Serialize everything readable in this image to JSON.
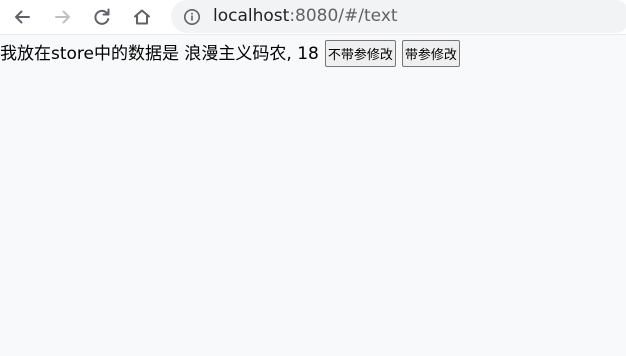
{
  "browser": {
    "url_host": "localhost",
    "url_rest": ":8080/#/text",
    "icons": {
      "back": "back-arrow-icon",
      "forward": "forward-arrow-icon",
      "reload": "reload-icon",
      "home": "home-icon",
      "info": "info-icon"
    }
  },
  "page": {
    "message_prefix": "我放在store中的数据是",
    "name": "浪漫主义码农",
    "separator": ",",
    "age": "18",
    "buttons": {
      "modify_no_param": "不带参修改",
      "modify_with_param": "带参修改"
    }
  },
  "colors": {
    "toolbar_bg": "#ffffff",
    "omnibox_bg": "#f1f3f4",
    "page_bg": "#f8f9fa",
    "icon_active": "#5f6368",
    "icon_disabled": "#bdc1c6"
  }
}
